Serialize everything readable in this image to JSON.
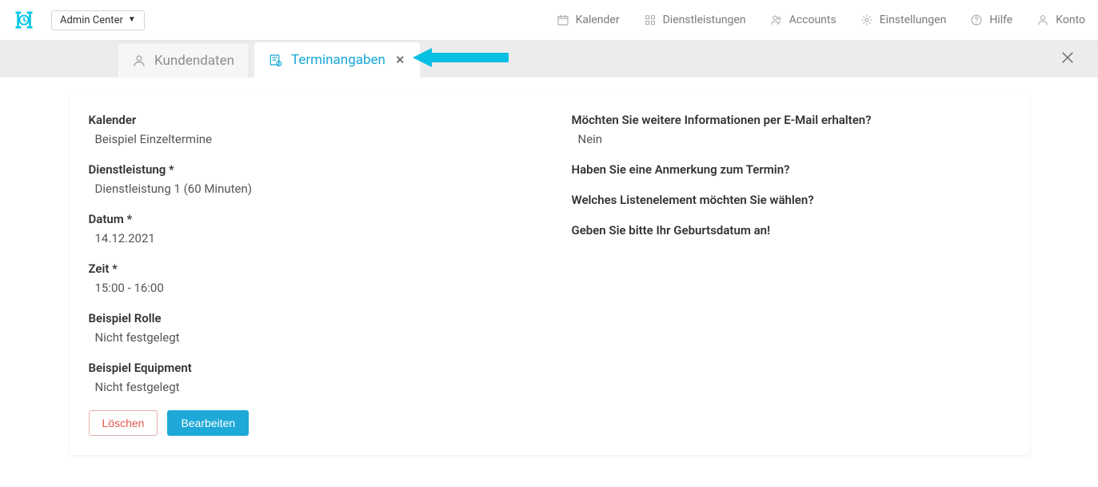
{
  "header": {
    "admin_center": "Admin Center",
    "nav": {
      "calendar": "Kalender",
      "services": "Dienstleistungen",
      "accounts": "Accounts",
      "settings": "Einstellungen",
      "help": "Hilfe",
      "account": "Konto"
    }
  },
  "tabs": {
    "customer_data": "Kundendaten",
    "appointment_details": "Terminangaben"
  },
  "left_fields": {
    "calendar_label": "Kalender",
    "calendar_value": "Beispiel Einzeltermine",
    "service_label": "Dienstleistung *",
    "service_value": "Dienstleistung 1 (60 Minuten)",
    "date_label": "Datum *",
    "date_value": "14.12.2021",
    "time_label": "Zeit *",
    "time_value": "15:00 - 16:00",
    "role_label": "Beispiel Rolle",
    "role_value": "Nicht festgelegt",
    "equipment_label": "Beispiel Equipment",
    "equipment_value": "Nicht festgelegt"
  },
  "right_fields": {
    "q1_label": "Möchten Sie weitere Informationen per E-Mail erhalten?",
    "q1_value": "Nein",
    "q2_label": "Haben Sie eine Anmerkung zum Termin?",
    "q2_value": "",
    "q3_label": "Welches Listenelement möchten Sie wählen?",
    "q3_value": "",
    "q4_label": "Geben Sie bitte Ihr Geburtsdatum an!",
    "q4_value": ""
  },
  "actions": {
    "delete": "Löschen",
    "edit": "Bearbeiten"
  }
}
